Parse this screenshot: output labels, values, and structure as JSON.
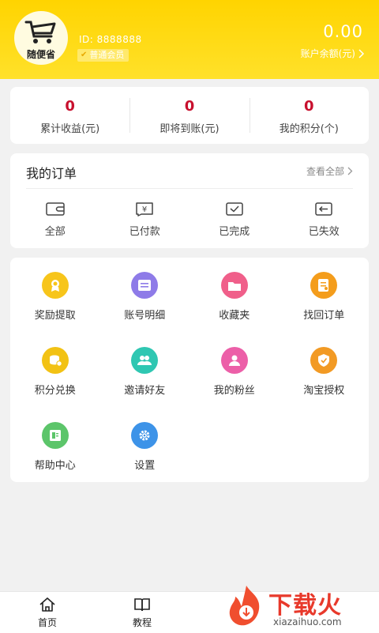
{
  "profile": {
    "logo_text": "随便省",
    "id_label": "ID:",
    "id_value": "8888888",
    "member_level": "普通会员",
    "balance_amount": "0.00",
    "balance_label": "账户余额(元)"
  },
  "stats": [
    {
      "value": "0",
      "label": "累计收益(元)"
    },
    {
      "value": "0",
      "label": "即将到账(元)"
    },
    {
      "value": "0",
      "label": "我的积分(个)"
    }
  ],
  "orders": {
    "title": "我的订单",
    "view_all": "查看全部",
    "items": [
      {
        "label": "全部",
        "icon": "wallet-icon"
      },
      {
        "label": "已付款",
        "icon": "yen-icon"
      },
      {
        "label": "已完成",
        "icon": "check-icon"
      },
      {
        "label": "已失效",
        "icon": "return-icon"
      }
    ]
  },
  "grid": [
    {
      "label": "奖励提取",
      "icon": "reward-icon",
      "color": "#f7c51b"
    },
    {
      "label": "账号明细",
      "icon": "account-detail-icon",
      "color": "#8e7be8"
    },
    {
      "label": "收藏夹",
      "icon": "folder-icon",
      "color": "#f05f8a"
    },
    {
      "label": "找回订单",
      "icon": "order-find-icon",
      "color": "#f49d1c"
    },
    {
      "label": "积分兑换",
      "icon": "coins-icon",
      "color": "#f2c214"
    },
    {
      "label": "邀请好友",
      "icon": "friends-icon",
      "color": "#2fc7b2"
    },
    {
      "label": "我的粉丝",
      "icon": "fans-icon",
      "color": "#ec5fa8"
    },
    {
      "label": "淘宝授权",
      "icon": "authorize-icon",
      "color": "#f29a24"
    },
    {
      "label": "帮助中心",
      "icon": "help-icon",
      "color": "#5cc56a"
    },
    {
      "label": "设置",
      "icon": "settings-icon",
      "color": "#3d93e8"
    }
  ],
  "nav": [
    {
      "label": "首页",
      "icon": "home-icon"
    },
    {
      "label": "教程",
      "icon": "book-icon"
    }
  ],
  "watermark": {
    "text": "下载火",
    "sub": "xiazaihuo.com"
  }
}
